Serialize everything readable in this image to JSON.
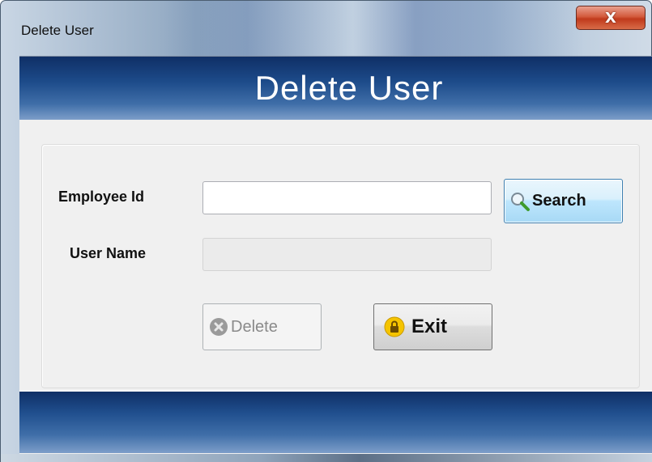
{
  "window": {
    "title": "Delete User",
    "close_symbol": "X"
  },
  "header": {
    "title": "Delete User"
  },
  "form": {
    "employee_id_label": "Employee Id",
    "employee_id_value": "",
    "user_name_label": "User Name",
    "user_name_value": ""
  },
  "buttons": {
    "search_label": "Search",
    "delete_label": "Delete",
    "exit_label": "Exit"
  },
  "icons": {
    "search": "magnifier-icon",
    "delete": "delete-x-icon",
    "exit": "padlock-icon",
    "close": "close-icon"
  },
  "colors": {
    "header_bar": "#1d4b8a",
    "client_bg": "#f0f0f0",
    "close_button": "#c03a1c",
    "search_button": "#bee6fd",
    "exit_icon": "#f5c400"
  }
}
